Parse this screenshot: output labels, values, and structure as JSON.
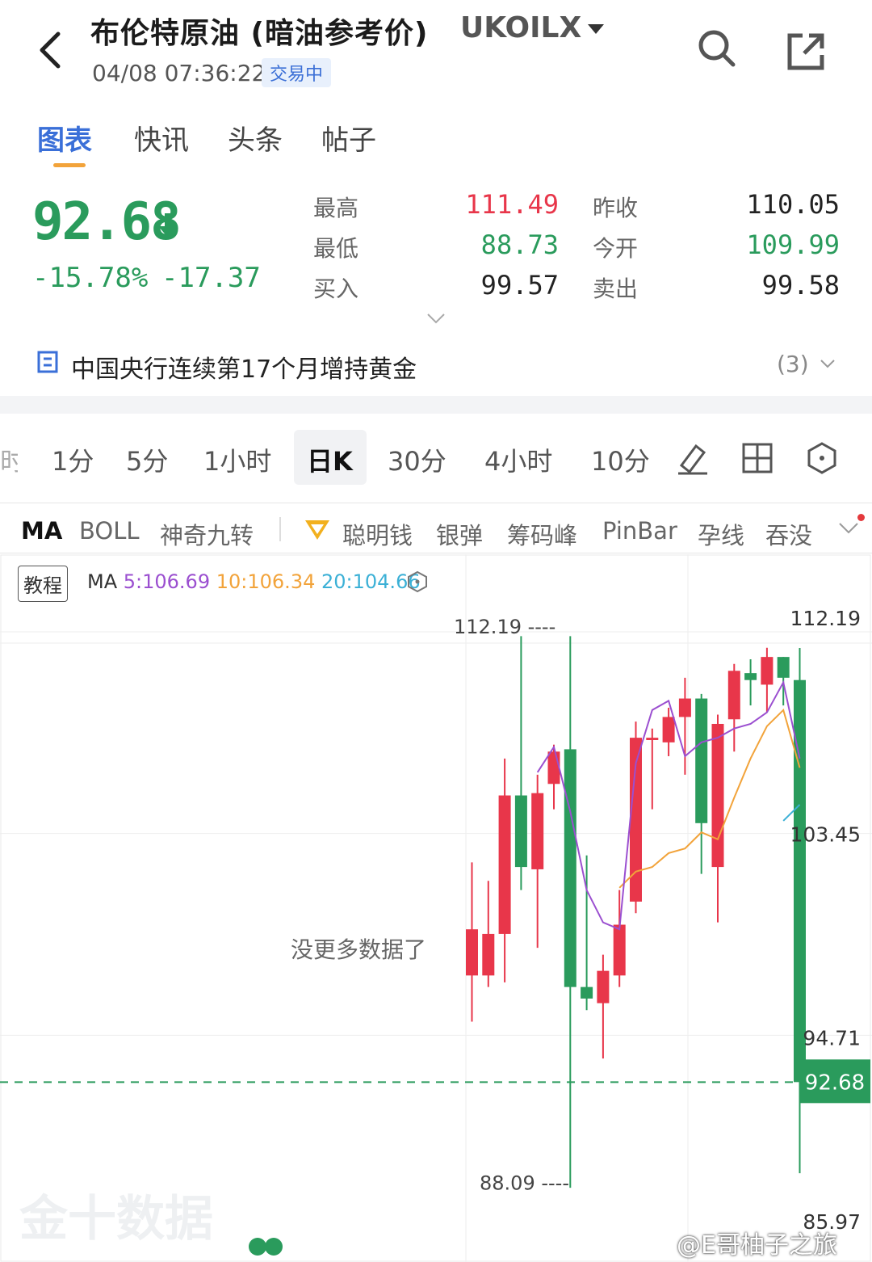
{
  "header": {
    "title": "布伦特原油 (暗油参考价)",
    "symbol": "UKOILX",
    "datetime": "04/08 07:36:22",
    "status": "交易中"
  },
  "tabs": [
    {
      "label": "图表"
    },
    {
      "label": "快讯"
    },
    {
      "label": "头条"
    },
    {
      "label": "帖子"
    }
  ],
  "quote": {
    "price": "92.68",
    "change_pct": "-15.78%",
    "change": "-17.37",
    "high_label": "最高",
    "high": "111.49",
    "low_label": "最低",
    "low": "88.73",
    "bid_label": "买入",
    "bid": "99.57",
    "prev_close_label": "昨收",
    "prev_close": "110.05",
    "open_label": "今开",
    "open": "109.99",
    "ask_label": "卖出",
    "ask": "99.58"
  },
  "news": {
    "headline": "中国央行连续第17个月增持黄金",
    "count": "(3)"
  },
  "periods": {
    "cut": "时",
    "p1": "1分",
    "p2": "5分",
    "p3": "1小时",
    "active": "日K",
    "p5": "30分",
    "p6": "4小时",
    "p7": "10分"
  },
  "indicators": [
    "MA",
    "BOLL",
    "神奇九转",
    "聪明钱",
    "银弹",
    "筹码峰",
    "PinBar",
    "孕线",
    "吞没"
  ],
  "ma_legend": {
    "tutorial": "教程",
    "prefix": "MA",
    "ma5": "5:106.69",
    "ma10": "10:106.34",
    "ma20": "20:104.66"
  },
  "colors": {
    "up": "#e8364a",
    "down": "#2a9b5c",
    "ma5": "#9b4fd0",
    "ma10": "#f2a33a",
    "ma20": "#3bb0d6",
    "accent": "#3a6fd8"
  },
  "chart": {
    "no_more_data": "没更多数据了",
    "hi_label": "112.19",
    "lo_label": "88.09",
    "axis": [
      "112.19",
      "103.45",
      "94.71",
      "85.97"
    ],
    "last_price_tag": "92.68"
  },
  "chart_data": {
    "type": "candlestick",
    "ylim": [
      85.97,
      112.19
    ],
    "last_price": 92.68,
    "candles": [
      {
        "o": 97.3,
        "c": 99.3,
        "h": 102.2,
        "l": 95.3
      },
      {
        "o": 97.3,
        "c": 99.1,
        "h": 101.4,
        "l": 96.8
      },
      {
        "o": 99.1,
        "c": 105.1,
        "h": 106.7,
        "l": 97.0
      },
      {
        "o": 105.1,
        "c": 102.0,
        "h": 112.0,
        "l": 101.0
      },
      {
        "o": 101.9,
        "c": 105.2,
        "h": 106.0,
        "l": 98.5
      },
      {
        "o": 105.6,
        "c": 107.0,
        "h": 107.3,
        "l": 104.5
      },
      {
        "o": 107.1,
        "c": 96.8,
        "h": 112.0,
        "l": 88.1
      },
      {
        "o": 96.8,
        "c": 96.3,
        "h": 102.5,
        "l": 95.8
      },
      {
        "o": 96.1,
        "c": 97.5,
        "h": 98.2,
        "l": 93.7
      },
      {
        "o": 97.3,
        "c": 99.5,
        "h": 101.0,
        "l": 96.8
      },
      {
        "o": 100.5,
        "c": 107.6,
        "h": 108.3,
        "l": 100.0
      },
      {
        "o": 107.5,
        "c": 107.6,
        "h": 108.0,
        "l": 104.5
      },
      {
        "o": 107.4,
        "c": 108.5,
        "h": 108.9,
        "l": 106.8
      },
      {
        "o": 108.5,
        "c": 109.3,
        "h": 110.2,
        "l": 106.0
      },
      {
        "o": 109.3,
        "c": 103.9,
        "h": 109.5,
        "l": 101.7
      },
      {
        "o": 102.0,
        "c": 108.2,
        "h": 108.6,
        "l": 99.6
      },
      {
        "o": 108.4,
        "c": 110.5,
        "h": 110.8,
        "l": 107.0
      },
      {
        "o": 110.4,
        "c": 110.1,
        "h": 111.0,
        "l": 109.0
      },
      {
        "o": 109.9,
        "c": 111.1,
        "h": 111.5,
        "l": 108.7
      },
      {
        "o": 111.1,
        "c": 110.2,
        "h": 111.1,
        "l": 109.0
      },
      {
        "o": 110.1,
        "c": 92.68,
        "h": 111.49,
        "l": 88.73
      }
    ],
    "ma5": [
      null,
      null,
      null,
      null,
      106.1,
      107.2,
      104.4,
      101.0,
      99.6,
      99.3,
      106.5,
      108.8,
      109.2,
      106.8,
      107.4,
      107.6,
      108.0,
      108.2,
      108.7,
      110.0,
      106.7
    ],
    "ma10": [
      null,
      null,
      null,
      null,
      null,
      null,
      null,
      null,
      null,
      101.1,
      101.8,
      102.0,
      102.6,
      102.8,
      103.5,
      103.2,
      105.0,
      106.7,
      108.1,
      108.8,
      106.3
    ],
    "ma20": [
      null,
      null,
      null,
      null,
      null,
      null,
      null,
      null,
      null,
      null,
      null,
      null,
      null,
      null,
      null,
      null,
      null,
      null,
      null,
      104.0,
      104.7
    ]
  }
}
